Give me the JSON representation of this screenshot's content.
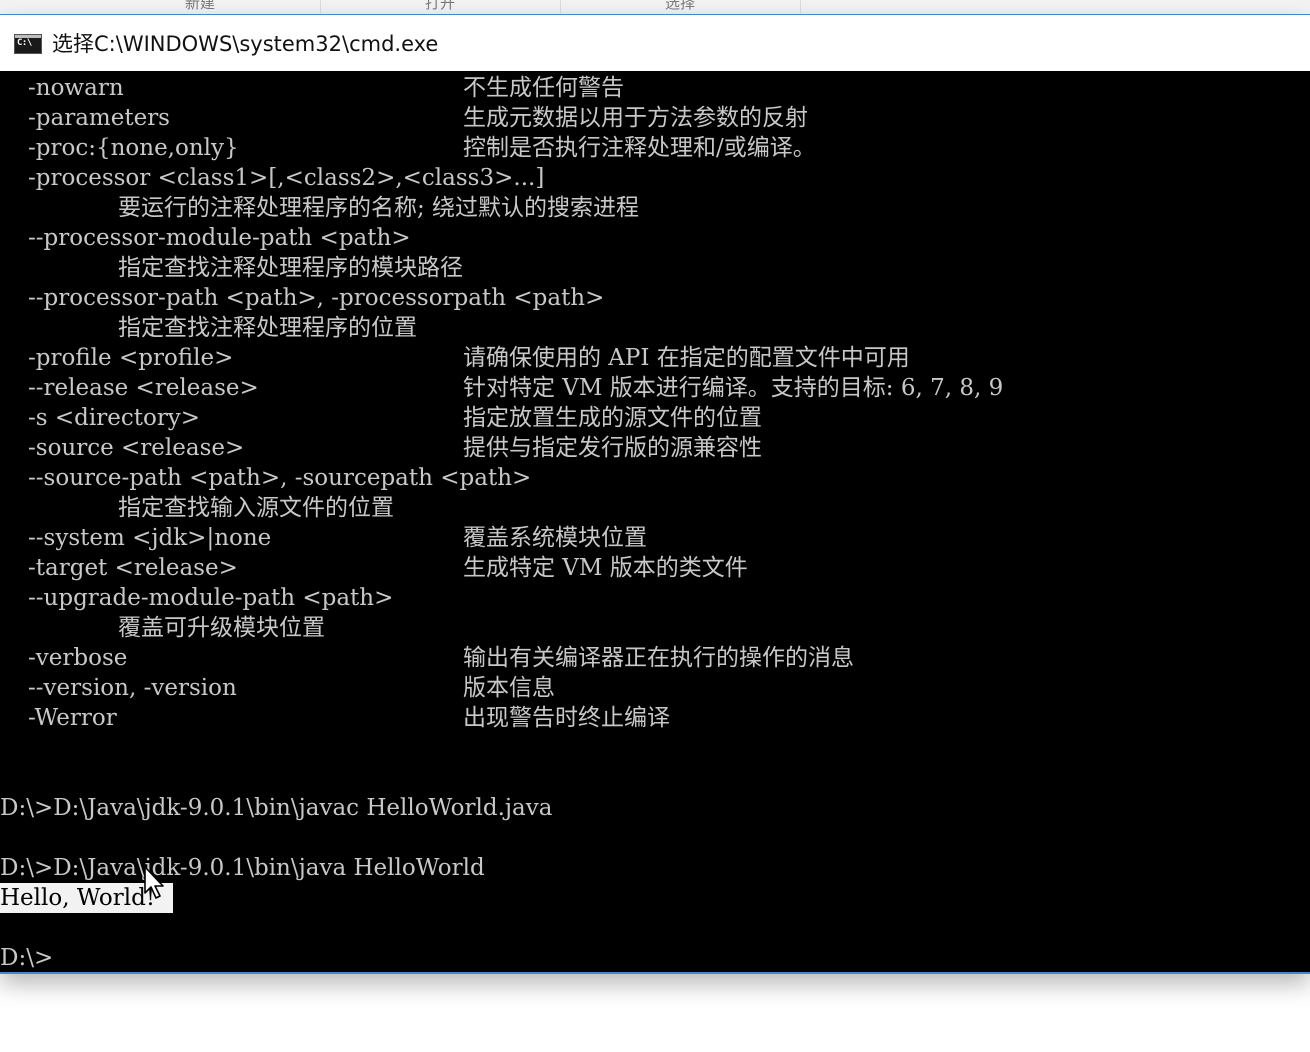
{
  "explorer_ribbon": {
    "groups": [
      "新建",
      "打开",
      "选择"
    ]
  },
  "window": {
    "title": "选择C:\\WINDOWS\\system32\\cmd.exe",
    "icon": "cmd-console-icon",
    "icon_glyph": "C:\\"
  },
  "console": {
    "options": [
      {
        "flag": "-nowarn",
        "desc": "不生成任何警告"
      },
      {
        "flag": "-parameters",
        "desc": "生成元数据以用于方法参数的反射"
      },
      {
        "flag": "-proc:{none,only}",
        "desc": "控制是否执行注释处理和/或编译。"
      },
      {
        "flag": "-processor <class1>[,<class2>,<class3>...]",
        "desc": ""
      },
      {
        "flag": "",
        "sub": "要运行的注释处理程序的名称; 绕过默认的搜索进程"
      },
      {
        "flag": "--processor-module-path <path>",
        "desc": ""
      },
      {
        "flag": "",
        "sub": "指定查找注释处理程序的模块路径"
      },
      {
        "flag": "--processor-path <path>, -processorpath <path>",
        "desc": ""
      },
      {
        "flag": "",
        "sub": "指定查找注释处理程序的位置"
      },
      {
        "flag": "-profile <profile>",
        "desc": "请确保使用的 API 在指定的配置文件中可用"
      },
      {
        "flag": "--release <release>",
        "desc": "针对特定 VM 版本进行编译。支持的目标: 6, 7, 8, 9"
      },
      {
        "flag": "-s <directory>",
        "desc": "指定放置生成的源文件的位置"
      },
      {
        "flag": "-source <release>",
        "desc": "提供与指定发行版的源兼容性"
      },
      {
        "flag": "--source-path <path>, -sourcepath <path>",
        "desc": ""
      },
      {
        "flag": "",
        "sub": "指定查找输入源文件的位置"
      },
      {
        "flag": "--system <jdk>|none",
        "desc": "覆盖系统模块位置"
      },
      {
        "flag": "-target <release>",
        "desc": "生成特定 VM 版本的类文件"
      },
      {
        "flag": "--upgrade-module-path <path>",
        "desc": ""
      },
      {
        "flag": "",
        "sub": "覆盖可升级模块位置"
      },
      {
        "flag": "-verbose",
        "desc": "输出有关编译器正在执行的操作的消息"
      },
      {
        "flag": "--version, -version",
        "desc": "版本信息"
      },
      {
        "flag": "-Werror",
        "desc": "出现警告时终止编译"
      }
    ],
    "command_javac": "D:\\>D:\\Java\\jdk-9.0.1\\bin\\javac HelloWorld.java",
    "command_java": "D:\\>D:\\Java\\jdk-9.0.1\\bin\\java HelloWorld",
    "output_selected": "Hello, World!",
    "final_prompt": "D:\\>"
  },
  "colors": {
    "console_bg": "#000000",
    "console_text": "#c8c8c8",
    "selection_bg": "#f2f2f2",
    "window_border": "#3c8ad6"
  }
}
